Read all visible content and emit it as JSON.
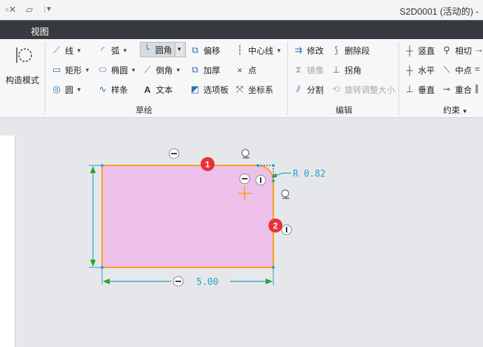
{
  "window": {
    "title": "S2D0001 (活动的) -"
  },
  "menu": {
    "tabs": [
      {
        "label": "视图"
      }
    ]
  },
  "ribbon": {
    "mode": {
      "label": "构造模式"
    },
    "sketch": {
      "group_label": "草绘",
      "line": "线",
      "arc": "弧",
      "fillet": "圆角",
      "offset": "偏移",
      "centerline": "中心线",
      "rectangle": "矩形",
      "ellipse": "椭圆",
      "chamfer": "倒角",
      "thicken": "加厚",
      "point": "点",
      "circle": "圆",
      "spline": "样条",
      "text": "文本",
      "palette": "选项板",
      "coord_sys": "坐标系"
    },
    "edit": {
      "group_label": "编辑",
      "modify": "修改",
      "delete_segment": "删除段",
      "mirror": "镜像",
      "corner": "拐角",
      "divide": "分割",
      "rotate_resize": "旋转调整大小"
    },
    "constrain": {
      "group_label": "约束",
      "vertical": "竖直",
      "tangent": "相切",
      "horizontal": "水平",
      "midpoint": "中点",
      "perpendicular": "垂直",
      "coincident": "重合"
    }
  },
  "sketch": {
    "fill_color": "#edc0ea",
    "edge_color": "#f5a016",
    "dim_color": "#1fa3c8",
    "radius_label": "R 0.82",
    "width_label": "5.00",
    "markers": [
      "1",
      "2"
    ]
  }
}
